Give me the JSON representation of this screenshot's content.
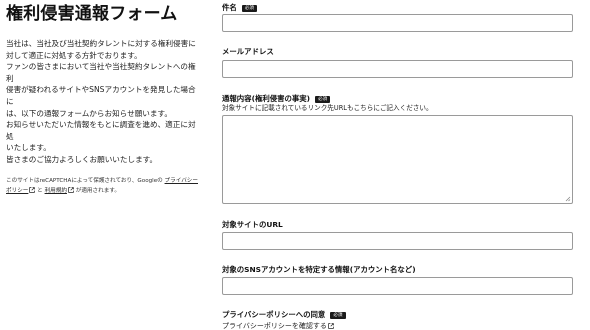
{
  "left": {
    "title": "権利侵害通報フォーム",
    "intro": [
      "当社は、当社及び当社契約タレントに対する権利侵害に",
      "対して適正に対処する方針でおります。",
      "ファンの皆さまにおいて当社や当社契約タレントへの権利",
      "侵害が疑われるサイトやSNSアカウントを発見した場合に",
      "は、以下の通報フォームからお知らせ願います。",
      "お知らせいただいた情報をもとに調査を進め、適正に対処",
      "いたします。",
      "皆さまのご協力よろしくお願いいたします。"
    ],
    "recaptcha": {
      "prefix": "このサイトはreCAPTCHAによって保護されており、Googleの",
      "privacy_link": "プライバシーポリシー",
      "and": "と",
      "terms_link": "利用規約",
      "suffix": "が適用されます。"
    }
  },
  "form": {
    "required_badge": "必須",
    "name": {
      "label": "件名",
      "value": ""
    },
    "email": {
      "label": "メールアドレス",
      "value": ""
    },
    "content": {
      "label": "通報内容(権利侵害の事実)",
      "description": "対象サイトに記載されているリンク先URLもこちらにご記入ください。",
      "value": ""
    },
    "url": {
      "label": "対象サイトのURL",
      "value": ""
    },
    "sns": {
      "label": "対象のSNSアカウントを特定する情報(アカウント名など)",
      "value": ""
    },
    "privacy": {
      "label": "プライバシーポリシーへの同意",
      "link": "プライバシーポリシーを確認する"
    }
  },
  "colors": {
    "text": "#111111",
    "badge_bg": "#1a1a1a",
    "input_border": "#9a9a9a"
  }
}
